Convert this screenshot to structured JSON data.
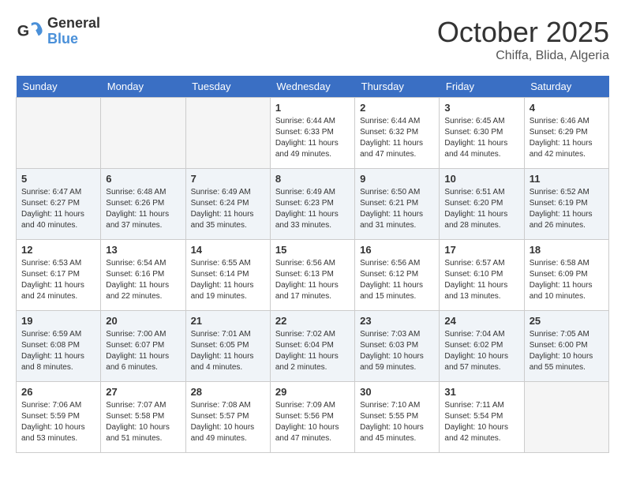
{
  "header": {
    "logo_general": "General",
    "logo_blue": "Blue",
    "month_title": "October 2025",
    "location": "Chiffa, Blida, Algeria"
  },
  "days_of_week": [
    "Sunday",
    "Monday",
    "Tuesday",
    "Wednesday",
    "Thursday",
    "Friday",
    "Saturday"
  ],
  "weeks": [
    {
      "days": [
        {
          "number": "",
          "info": ""
        },
        {
          "number": "",
          "info": ""
        },
        {
          "number": "",
          "info": ""
        },
        {
          "number": "1",
          "info": "Sunrise: 6:44 AM\nSunset: 6:33 PM\nDaylight: 11 hours\nand 49 minutes."
        },
        {
          "number": "2",
          "info": "Sunrise: 6:44 AM\nSunset: 6:32 PM\nDaylight: 11 hours\nand 47 minutes."
        },
        {
          "number": "3",
          "info": "Sunrise: 6:45 AM\nSunset: 6:30 PM\nDaylight: 11 hours\nand 44 minutes."
        },
        {
          "number": "4",
          "info": "Sunrise: 6:46 AM\nSunset: 6:29 PM\nDaylight: 11 hours\nand 42 minutes."
        }
      ]
    },
    {
      "days": [
        {
          "number": "5",
          "info": "Sunrise: 6:47 AM\nSunset: 6:27 PM\nDaylight: 11 hours\nand 40 minutes."
        },
        {
          "number": "6",
          "info": "Sunrise: 6:48 AM\nSunset: 6:26 PM\nDaylight: 11 hours\nand 37 minutes."
        },
        {
          "number": "7",
          "info": "Sunrise: 6:49 AM\nSunset: 6:24 PM\nDaylight: 11 hours\nand 35 minutes."
        },
        {
          "number": "8",
          "info": "Sunrise: 6:49 AM\nSunset: 6:23 PM\nDaylight: 11 hours\nand 33 minutes."
        },
        {
          "number": "9",
          "info": "Sunrise: 6:50 AM\nSunset: 6:21 PM\nDaylight: 11 hours\nand 31 minutes."
        },
        {
          "number": "10",
          "info": "Sunrise: 6:51 AM\nSunset: 6:20 PM\nDaylight: 11 hours\nand 28 minutes."
        },
        {
          "number": "11",
          "info": "Sunrise: 6:52 AM\nSunset: 6:19 PM\nDaylight: 11 hours\nand 26 minutes."
        }
      ]
    },
    {
      "days": [
        {
          "number": "12",
          "info": "Sunrise: 6:53 AM\nSunset: 6:17 PM\nDaylight: 11 hours\nand 24 minutes."
        },
        {
          "number": "13",
          "info": "Sunrise: 6:54 AM\nSunset: 6:16 PM\nDaylight: 11 hours\nand 22 minutes."
        },
        {
          "number": "14",
          "info": "Sunrise: 6:55 AM\nSunset: 6:14 PM\nDaylight: 11 hours\nand 19 minutes."
        },
        {
          "number": "15",
          "info": "Sunrise: 6:56 AM\nSunset: 6:13 PM\nDaylight: 11 hours\nand 17 minutes."
        },
        {
          "number": "16",
          "info": "Sunrise: 6:56 AM\nSunset: 6:12 PM\nDaylight: 11 hours\nand 15 minutes."
        },
        {
          "number": "17",
          "info": "Sunrise: 6:57 AM\nSunset: 6:10 PM\nDaylight: 11 hours\nand 13 minutes."
        },
        {
          "number": "18",
          "info": "Sunrise: 6:58 AM\nSunset: 6:09 PM\nDaylight: 11 hours\nand 10 minutes."
        }
      ]
    },
    {
      "days": [
        {
          "number": "19",
          "info": "Sunrise: 6:59 AM\nSunset: 6:08 PM\nDaylight: 11 hours\nand 8 minutes."
        },
        {
          "number": "20",
          "info": "Sunrise: 7:00 AM\nSunset: 6:07 PM\nDaylight: 11 hours\nand 6 minutes."
        },
        {
          "number": "21",
          "info": "Sunrise: 7:01 AM\nSunset: 6:05 PM\nDaylight: 11 hours\nand 4 minutes."
        },
        {
          "number": "22",
          "info": "Sunrise: 7:02 AM\nSunset: 6:04 PM\nDaylight: 11 hours\nand 2 minutes."
        },
        {
          "number": "23",
          "info": "Sunrise: 7:03 AM\nSunset: 6:03 PM\nDaylight: 10 hours\nand 59 minutes."
        },
        {
          "number": "24",
          "info": "Sunrise: 7:04 AM\nSunset: 6:02 PM\nDaylight: 10 hours\nand 57 minutes."
        },
        {
          "number": "25",
          "info": "Sunrise: 7:05 AM\nSunset: 6:00 PM\nDaylight: 10 hours\nand 55 minutes."
        }
      ]
    },
    {
      "days": [
        {
          "number": "26",
          "info": "Sunrise: 7:06 AM\nSunset: 5:59 PM\nDaylight: 10 hours\nand 53 minutes."
        },
        {
          "number": "27",
          "info": "Sunrise: 7:07 AM\nSunset: 5:58 PM\nDaylight: 10 hours\nand 51 minutes."
        },
        {
          "number": "28",
          "info": "Sunrise: 7:08 AM\nSunset: 5:57 PM\nDaylight: 10 hours\nand 49 minutes."
        },
        {
          "number": "29",
          "info": "Sunrise: 7:09 AM\nSunset: 5:56 PM\nDaylight: 10 hours\nand 47 minutes."
        },
        {
          "number": "30",
          "info": "Sunrise: 7:10 AM\nSunset: 5:55 PM\nDaylight: 10 hours\nand 45 minutes."
        },
        {
          "number": "31",
          "info": "Sunrise: 7:11 AM\nSunset: 5:54 PM\nDaylight: 10 hours\nand 42 minutes."
        },
        {
          "number": "",
          "info": ""
        }
      ]
    }
  ]
}
